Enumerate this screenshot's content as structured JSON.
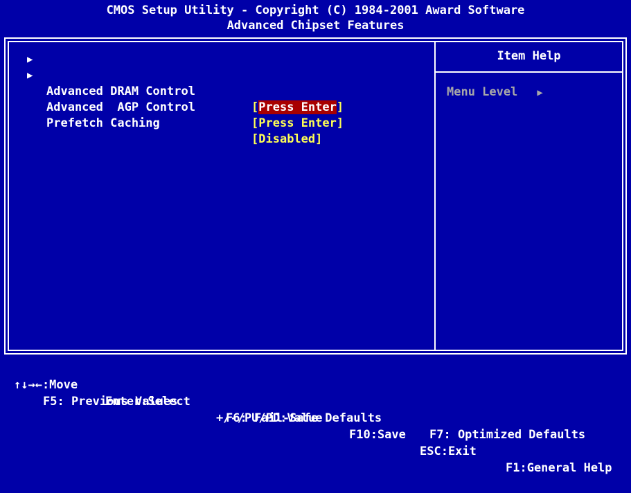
{
  "header": {
    "title": "CMOS Setup Utility - Copyright (C) 1984-2001 Award Software",
    "subtitle": "Advanced Chipset Features"
  },
  "menu": {
    "items": [
      {
        "pointer": "▶",
        "label": "Advanced DRAM Control",
        "value_open": "[",
        "value": "Press Enter",
        "value_close": "]",
        "selected": true
      },
      {
        "pointer": "▶",
        "label": "Advanced  AGP Control",
        "value_open": "[",
        "value": "Press Enter",
        "value_close": "]",
        "selected": false
      },
      {
        "pointer": "",
        "label": "Prefetch Caching",
        "value_open": "[",
        "value": "Disabled",
        "value_close": "]",
        "selected": false
      }
    ]
  },
  "help": {
    "title": "Item Help",
    "menu_level_label": "Menu Level",
    "menu_level_indicator": "▶"
  },
  "footer": {
    "line1": {
      "move": "↑↓→←:Move",
      "select": "Enter:Select",
      "value": "+/-/PU/PD:Value",
      "save": "F10:Save",
      "exit": "ESC:Exit",
      "help": "F1:General Help"
    },
    "line2": {
      "previous": "F5: Previous Values",
      "failsafe": "F6: Fail-Safe Defaults",
      "optimized": "F7: Optimized Defaults"
    }
  },
  "colors": {
    "background": "#0000a8",
    "text": "#ffffff",
    "value": "#ffff54",
    "highlight": "#a80000",
    "dim": "#a8a8a8"
  }
}
